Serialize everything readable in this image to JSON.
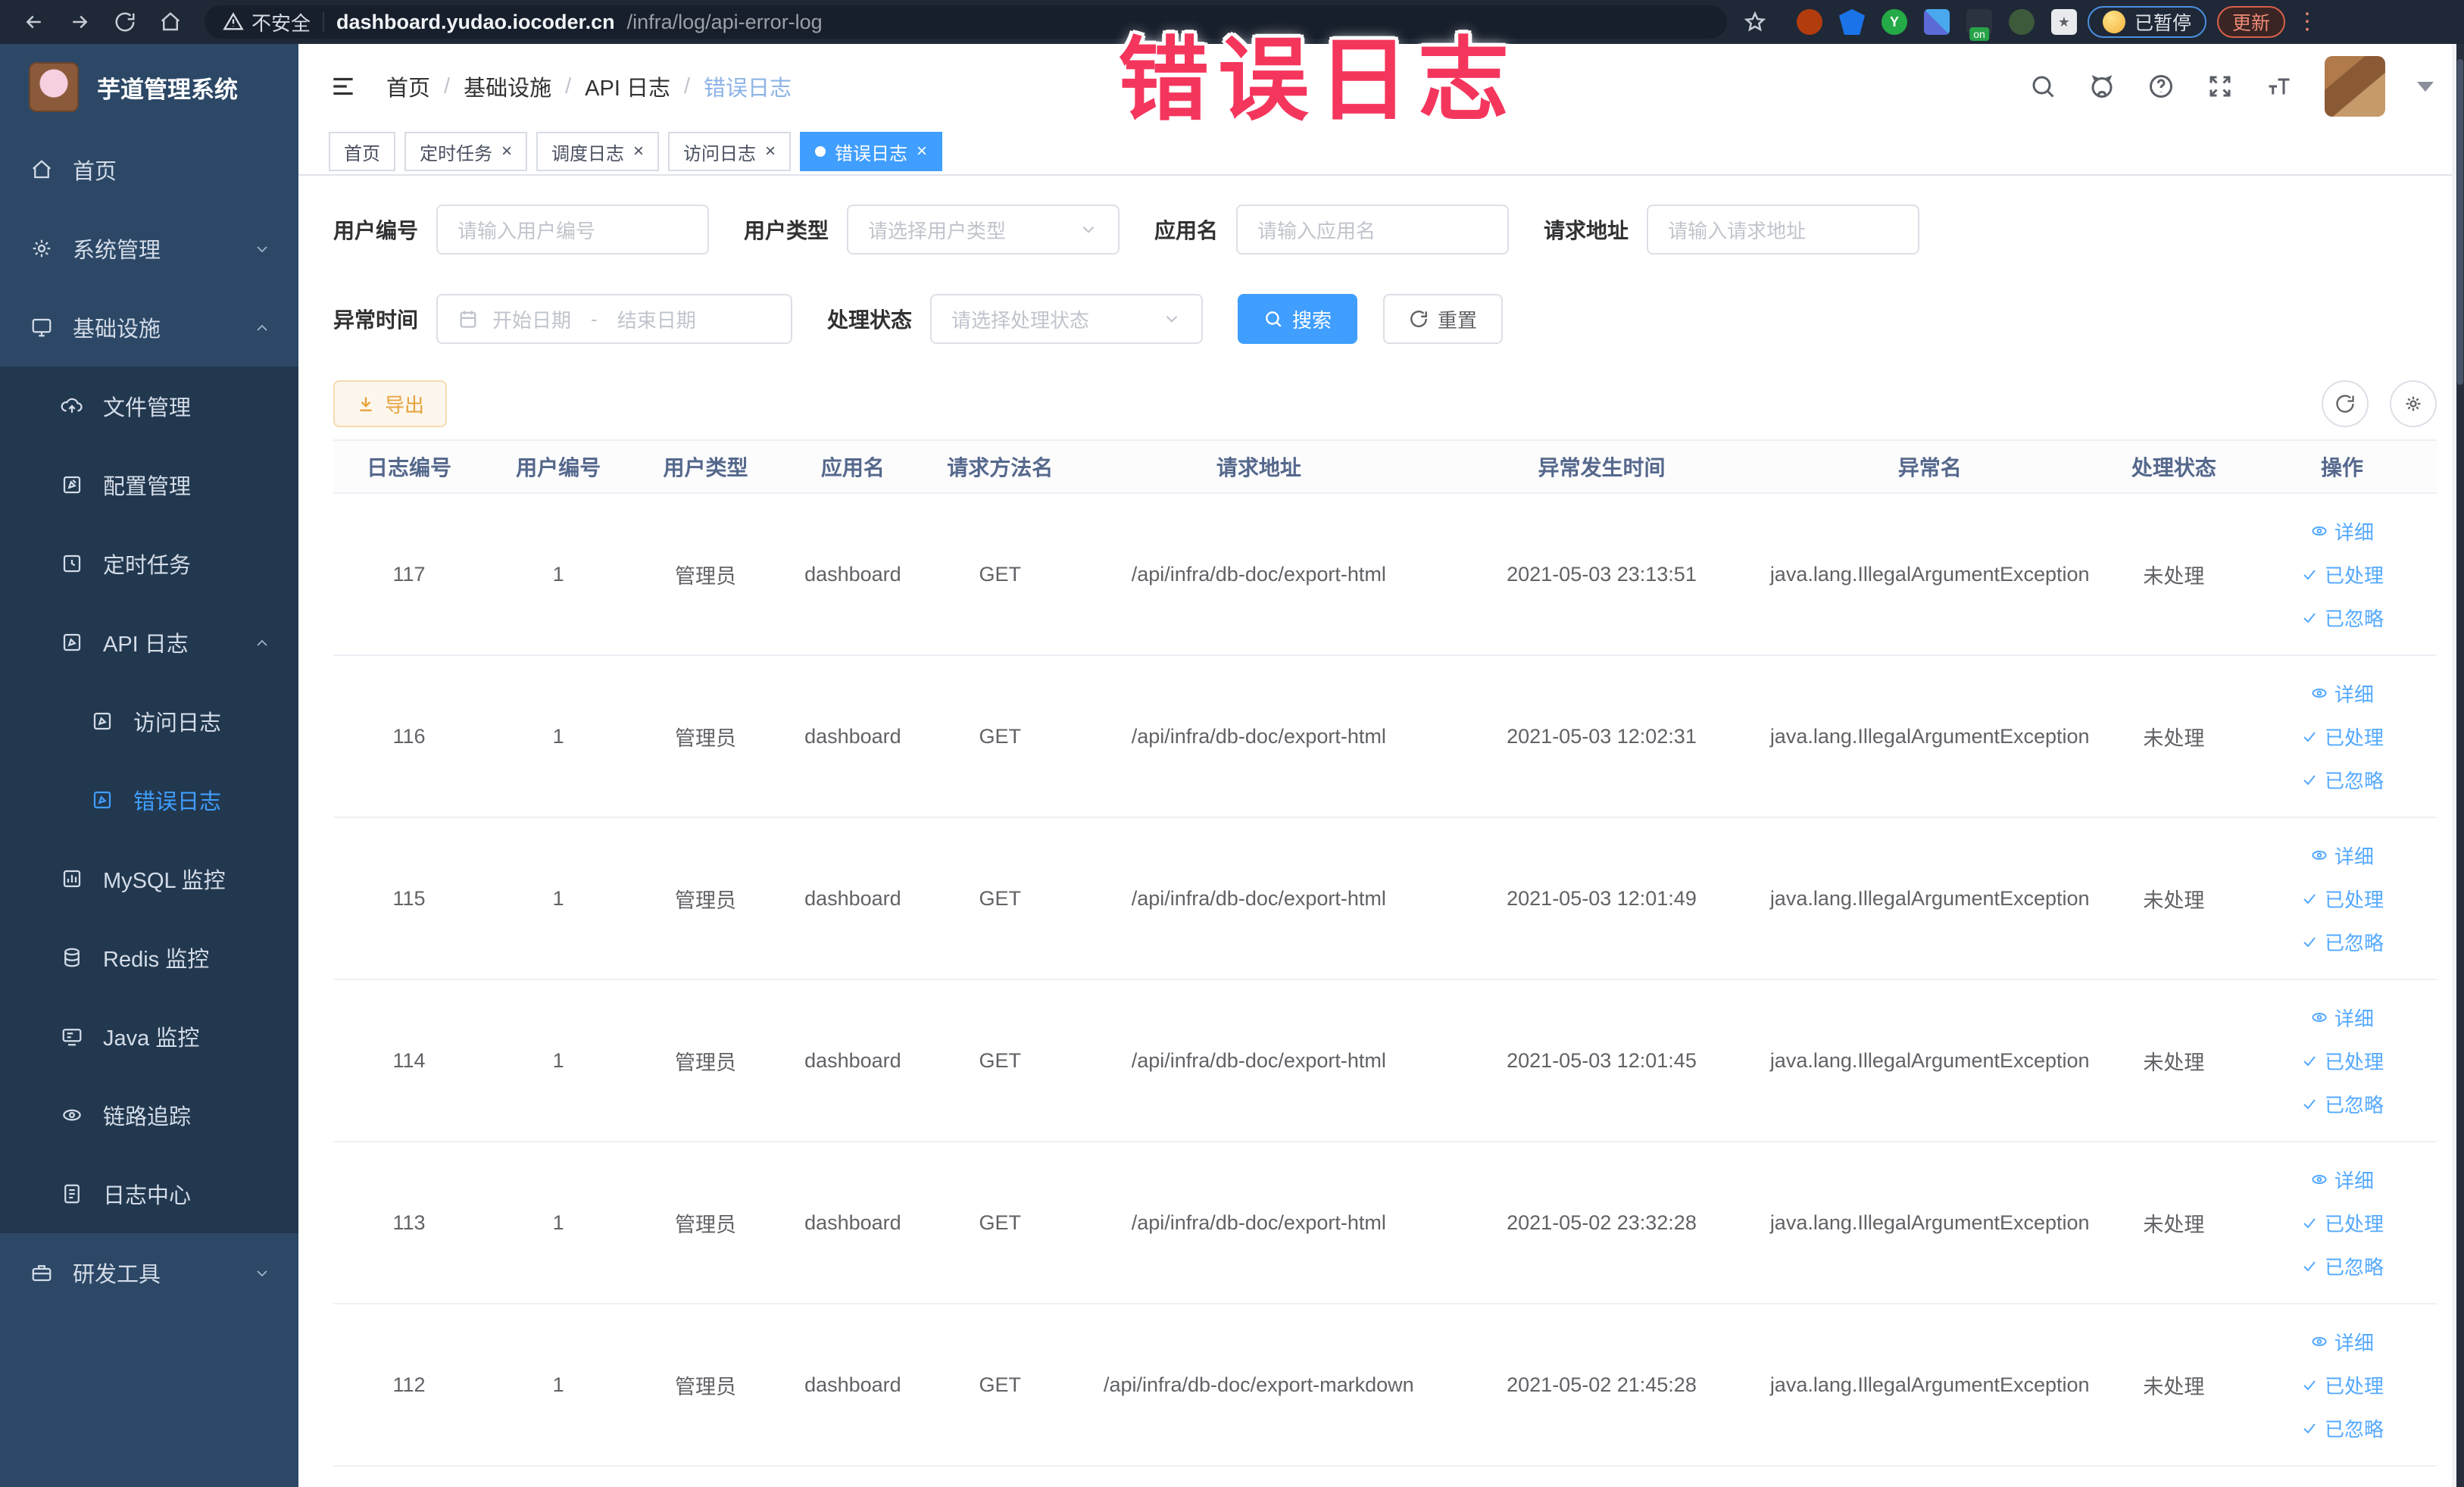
{
  "overlay": {
    "text": "错误日志",
    "color": "#f5365c"
  },
  "browser": {
    "security_label": "不安全",
    "url_host": "dashboard.yudao.iocoder.cn",
    "url_path": "/infra/log/api-error-log",
    "paused_chip": "已暂停",
    "update_chip": "更新",
    "on_badge": "on"
  },
  "sidebar": {
    "logo_title": "芋道管理系统",
    "items": [
      {
        "label": "首页"
      },
      {
        "label": "系统管理"
      },
      {
        "label": "基础设施"
      },
      {
        "label": "文件管理"
      },
      {
        "label": "配置管理"
      },
      {
        "label": "定时任务"
      },
      {
        "label": "API 日志"
      },
      {
        "label": "访问日志"
      },
      {
        "label": "错误日志"
      },
      {
        "label": "MySQL 监控"
      },
      {
        "label": "Redis 监控"
      },
      {
        "label": "Java 监控"
      },
      {
        "label": "链路追踪"
      },
      {
        "label": "日志中心"
      },
      {
        "label": "研发工具"
      }
    ]
  },
  "breadcrumb": {
    "items": [
      "首页",
      "基础设施",
      "API 日志",
      "错误日志"
    ],
    "separator": "/"
  },
  "tabs": [
    {
      "label": "首页"
    },
    {
      "label": "定时任务"
    },
    {
      "label": "调度日志"
    },
    {
      "label": "访问日志"
    },
    {
      "label": "错误日志"
    }
  ],
  "filters": {
    "user_id": {
      "label": "用户编号",
      "placeholder": "请输入用户编号"
    },
    "user_type": {
      "label": "用户类型",
      "placeholder": "请选择用户类型"
    },
    "app_name": {
      "label": "应用名",
      "placeholder": "请输入应用名"
    },
    "request_url": {
      "label": "请求地址",
      "placeholder": "请输入请求地址"
    },
    "exception_time": {
      "label": "异常时间",
      "start_placeholder": "开始日期",
      "separator": "-",
      "end_placeholder": "结束日期"
    },
    "process_status": {
      "label": "处理状态",
      "placeholder": "请选择处理状态"
    },
    "search_label": "搜索",
    "reset_label": "重置"
  },
  "toolbar": {
    "export_label": "导出"
  },
  "table": {
    "columns": [
      "日志编号",
      "用户编号",
      "用户类型",
      "应用名",
      "请求方法名",
      "请求地址",
      "异常发生时间",
      "异常名",
      "处理状态",
      "操作"
    ],
    "actions": {
      "detail": "详细",
      "processed": "已处理",
      "ignored": "已忽略"
    },
    "rows": [
      {
        "id": "117",
        "user_id": "1",
        "user_type": "管理员",
        "app": "dashboard",
        "method": "GET",
        "url": "/api/infra/db-doc/export-html",
        "time": "2021-05-03 23:13:51",
        "exception": "java.lang.IllegalArgumentException",
        "status": "未处理"
      },
      {
        "id": "116",
        "user_id": "1",
        "user_type": "管理员",
        "app": "dashboard",
        "method": "GET",
        "url": "/api/infra/db-doc/export-html",
        "time": "2021-05-03 12:02:31",
        "exception": "java.lang.IllegalArgumentException",
        "status": "未处理"
      },
      {
        "id": "115",
        "user_id": "1",
        "user_type": "管理员",
        "app": "dashboard",
        "method": "GET",
        "url": "/api/infra/db-doc/export-html",
        "time": "2021-05-03 12:01:49",
        "exception": "java.lang.IllegalArgumentException",
        "status": "未处理"
      },
      {
        "id": "114",
        "user_id": "1",
        "user_type": "管理员",
        "app": "dashboard",
        "method": "GET",
        "url": "/api/infra/db-doc/export-html",
        "time": "2021-05-03 12:01:45",
        "exception": "java.lang.IllegalArgumentException",
        "status": "未处理"
      },
      {
        "id": "113",
        "user_id": "1",
        "user_type": "管理员",
        "app": "dashboard",
        "method": "GET",
        "url": "/api/infra/db-doc/export-html",
        "time": "2021-05-02 23:32:28",
        "exception": "java.lang.IllegalArgumentException",
        "status": "未处理"
      },
      {
        "id": "112",
        "user_id": "1",
        "user_type": "管理员",
        "app": "dashboard",
        "method": "GET",
        "url": "/api/infra/db-doc/export-markdown",
        "time": "2021-05-02 21:45:28",
        "exception": "java.lang.IllegalArgumentException",
        "status": "未处理"
      }
    ]
  },
  "colors": {
    "accent": "#409eff",
    "sidebar_bg": "#2c4866",
    "submenu_bg": "#22384f",
    "warning": "#e6a23c",
    "overlay_pink": "#f5365c"
  }
}
